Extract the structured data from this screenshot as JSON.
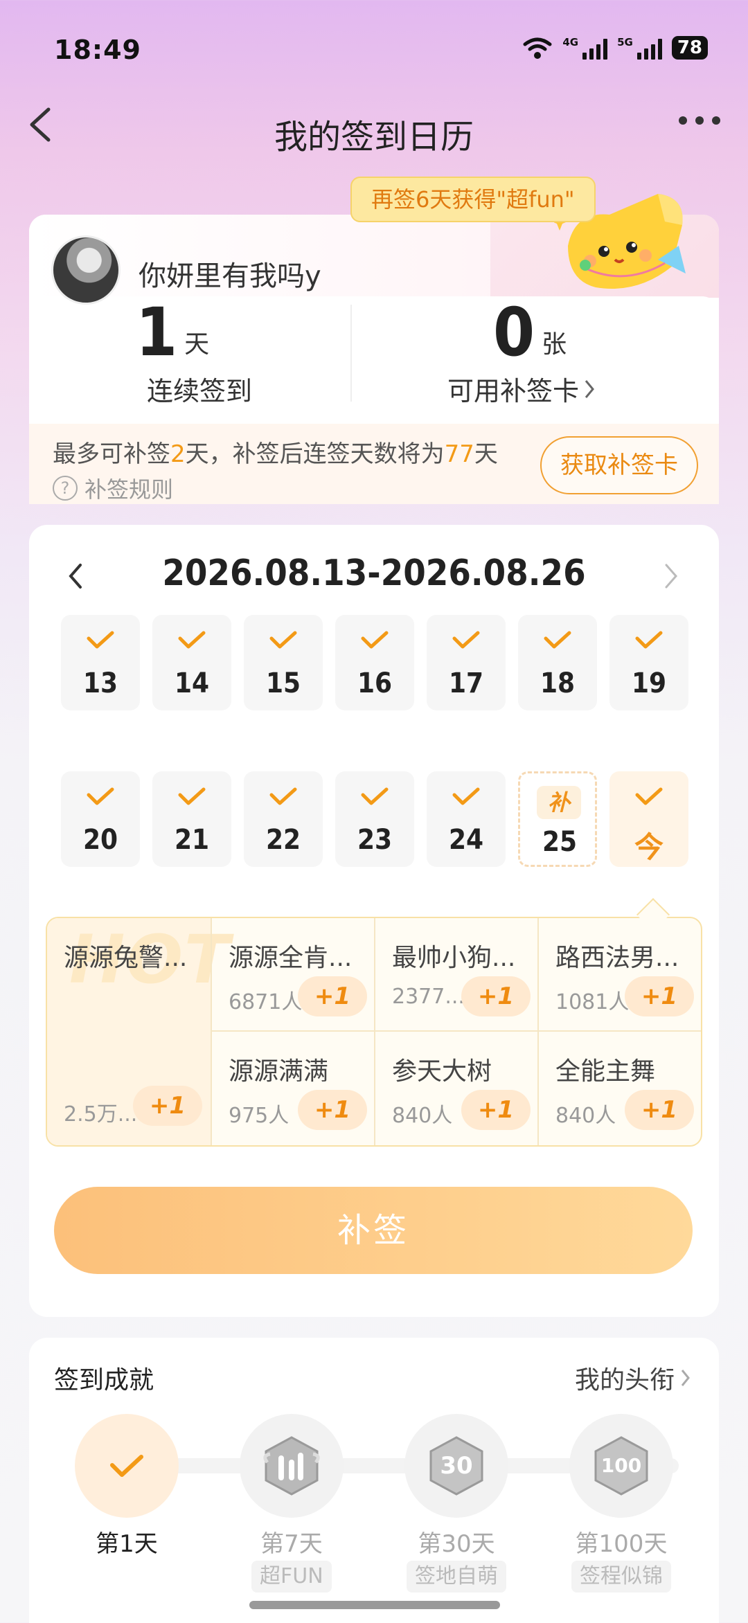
{
  "status_bar": {
    "time": "18:49",
    "net1": "4G",
    "net2": "5G",
    "battery": "78"
  },
  "nav": {
    "title": "我的签到日历"
  },
  "promo": {
    "text": "再签6天获得\"超fun\""
  },
  "profile": {
    "name": "你妍里有我吗y"
  },
  "stats": {
    "streak_num": "1",
    "streak_unit": "天",
    "streak_label": "连续签到",
    "cards_num": "0",
    "cards_unit": "张",
    "cards_label": "可用补签卡"
  },
  "makeup_info": {
    "prefix": "最多可补签",
    "days": "2",
    "mid": "天，补签后连签天数将为",
    "total": "77",
    "suffix": "天",
    "rule": "补签规则",
    "get_card": "获取补签卡"
  },
  "calendar": {
    "range": "2026.08.13-2026.08.26",
    "makeup_tag": "补",
    "row1": [
      "13",
      "14",
      "15",
      "16",
      "17",
      "18",
      "19"
    ],
    "row2": [
      "20",
      "21",
      "22",
      "23",
      "24",
      "25",
      "今"
    ]
  },
  "gifts": {
    "hot_label": "HOT",
    "plus": "+1",
    "items": [
      {
        "name": "源源兔警...",
        "count": "2.5万..."
      },
      {
        "name": "源源全肯...",
        "count": "6871人"
      },
      {
        "name": "最帅小狗...",
        "count": "2377..."
      },
      {
        "name": "路西法男...",
        "count": "1081人"
      },
      {
        "name": "源源满满",
        "count": "975人"
      },
      {
        "name": "参天大树",
        "count": "840人"
      },
      {
        "name": "全能主舞",
        "count": "840人"
      }
    ]
  },
  "makeup_button": "补签",
  "achievements": {
    "title": "签到成就",
    "link": "我的头衔",
    "items": [
      {
        "day": "第1天",
        "title": ""
      },
      {
        "day": "第7天",
        "title": "超FUN"
      },
      {
        "day": "第30天",
        "title": "签地自萌"
      },
      {
        "day": "第100天",
        "title": "签程似锦"
      }
    ]
  },
  "colors": {
    "accent": "#f39a16",
    "button": "#fcc07a"
  }
}
